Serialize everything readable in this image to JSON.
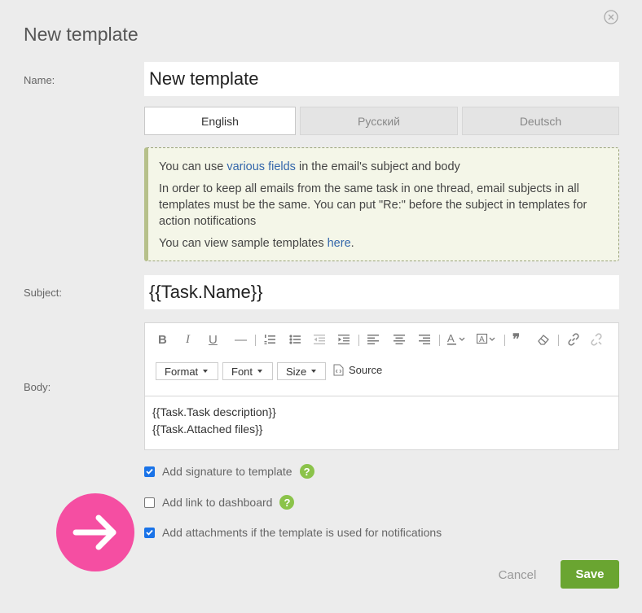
{
  "dialog": {
    "title": "New template",
    "close_icon": "close-icon"
  },
  "name_field": {
    "label": "Name:",
    "value": "New template"
  },
  "language_tabs": [
    {
      "label": "English",
      "active": true
    },
    {
      "label": "Русский",
      "active": false
    },
    {
      "label": "Deutsch",
      "active": false
    }
  ],
  "info": {
    "line1_pre": "You can use ",
    "line1_link": "various fields",
    "line1_post": " in the email's subject and body",
    "line2": "In order to keep all emails from the same task in one thread, email subjects in all templates must be the same. You can put \"Re:\" before the subject in templates for action notifications",
    "line3_pre": "You can view sample templates ",
    "line3_link": "here",
    "line3_post": "."
  },
  "subject_field": {
    "label": "Subject:",
    "value": "{{Task.Name}}"
  },
  "body_field": {
    "label": "Body:",
    "toolbar": {
      "format_label": "Format",
      "font_label": "Font",
      "size_label": "Size",
      "source_label": "Source"
    },
    "content_lines": [
      "{{Task.Task description}}",
      "{{Task.Attached files}}"
    ]
  },
  "options": [
    {
      "label": "Add signature to template",
      "checked": true,
      "help": true
    },
    {
      "label": "Add link to dashboard",
      "checked": false,
      "help": true
    },
    {
      "label": "Add attachments if the template is used for notifications",
      "checked": true,
      "help": false
    }
  ],
  "footer": {
    "cancel_label": "Cancel",
    "save_label": "Save"
  },
  "colors": {
    "accent_green": "#6aa531",
    "pink_marker": "#f54ea2",
    "checkbox_blue": "#1a73e8"
  }
}
